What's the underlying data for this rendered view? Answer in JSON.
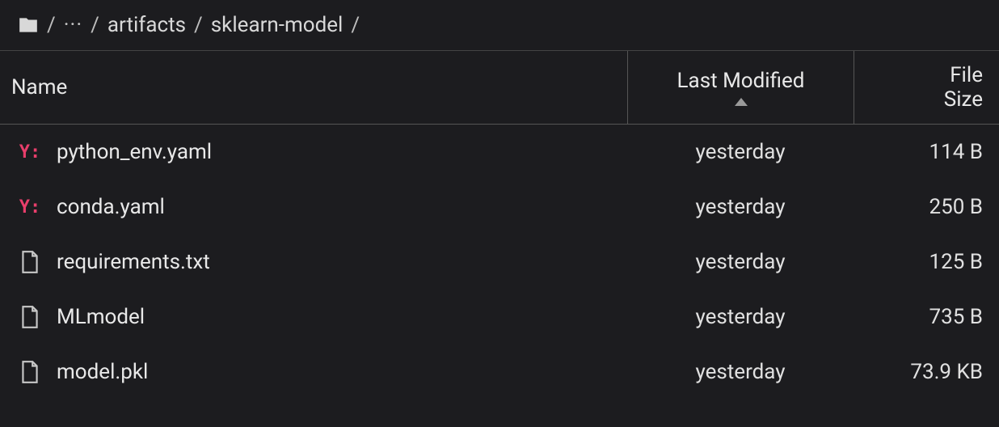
{
  "breadcrumb": {
    "ellipsis": "···",
    "crumbs": [
      "artifacts",
      "sklearn-model"
    ]
  },
  "headers": {
    "name": "Name",
    "modified": "Last Modified",
    "size_line1": "File",
    "size_line2": "Size"
  },
  "files": [
    {
      "icon": "yaml",
      "name": "python_env.yaml",
      "modified": "yesterday",
      "size": "114 B"
    },
    {
      "icon": "yaml",
      "name": "conda.yaml",
      "modified": "yesterday",
      "size": "250 B"
    },
    {
      "icon": "file",
      "name": "requirements.txt",
      "modified": "yesterday",
      "size": "125 B"
    },
    {
      "icon": "file",
      "name": "MLmodel",
      "modified": "yesterday",
      "size": "735 B"
    },
    {
      "icon": "file",
      "name": "model.pkl",
      "modified": "yesterday",
      "size": "73.9 KB"
    }
  ]
}
